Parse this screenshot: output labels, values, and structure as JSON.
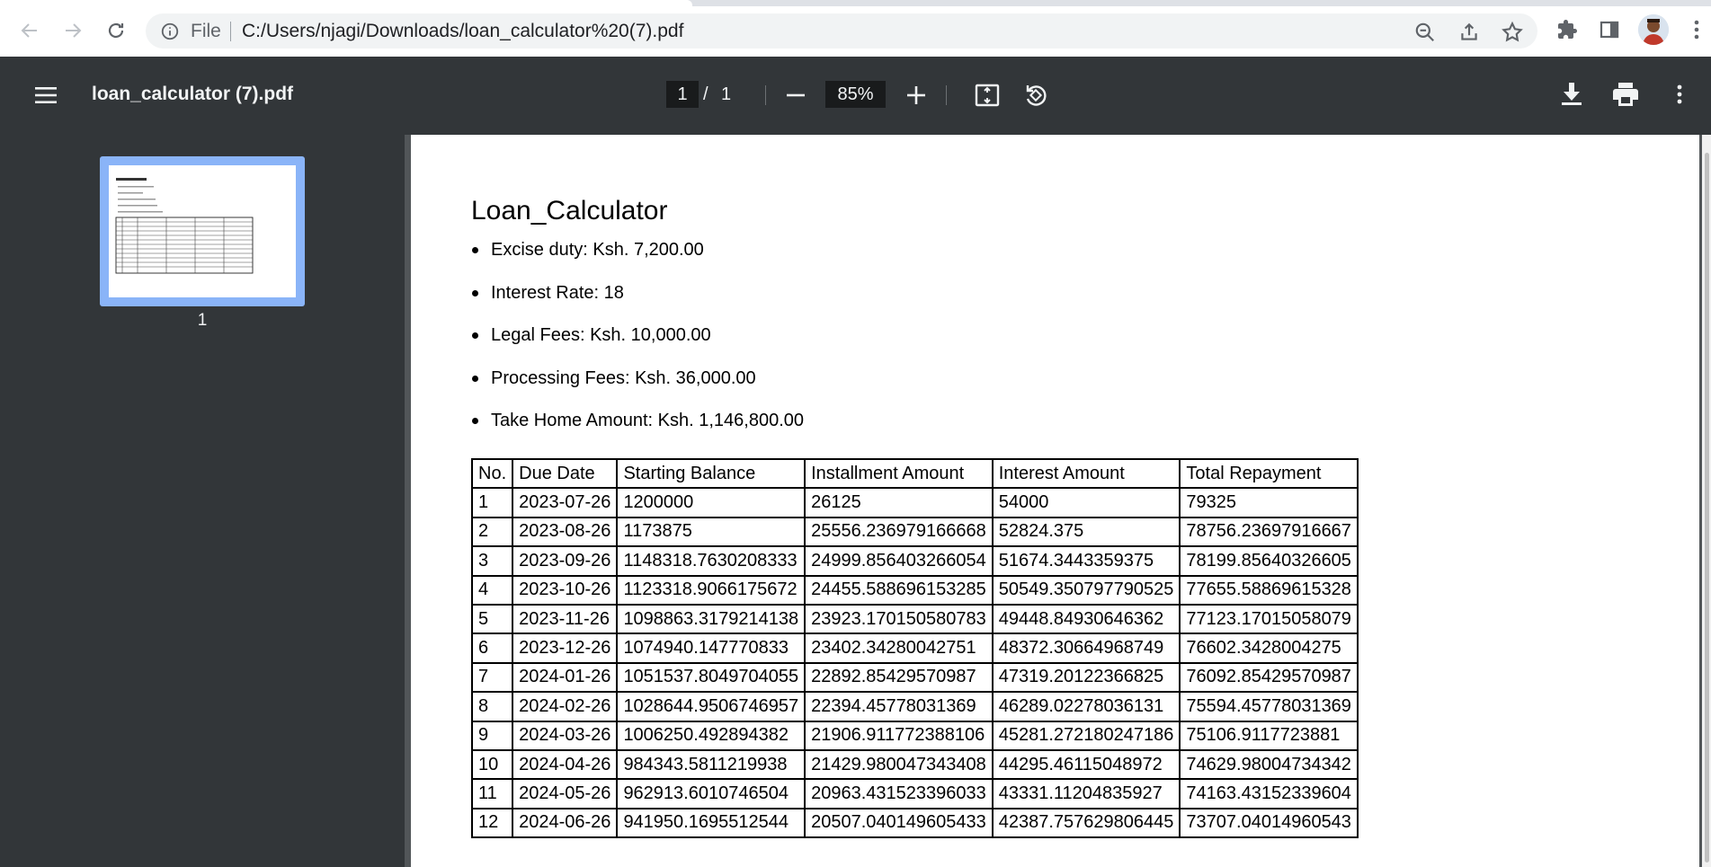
{
  "browser": {
    "omnibox_scheme": "File",
    "url": "C:/Users/njagi/Downloads/loan_calculator%20(7).pdf"
  },
  "viewer": {
    "doc_title": "loan_calculator (7).pdf",
    "current_page": "1",
    "page_separator": "/",
    "total_pages": "1",
    "zoom": "85%",
    "thumbnail_label": "1"
  },
  "document": {
    "title": "Loan_Calculator",
    "bullets": [
      "Excise duty: Ksh. 7,200.00",
      "Interest Rate: 18",
      "Legal Fees: Ksh. 10,000.00",
      "Processing Fees: Ksh. 36,000.00",
      "Take Home Amount: Ksh. 1,146,800.00"
    ],
    "table": {
      "headers": [
        "No.",
        "Due Date",
        "Starting Balance",
        "Installment Amount",
        "Interest Amount",
        "Total Repayment"
      ],
      "rows": [
        [
          "1",
          "2023-07-26",
          "1200000",
          "26125",
          "54000",
          "79325"
        ],
        [
          "2",
          "2023-08-26",
          "1173875",
          "25556.236979166668",
          "52824.375",
          "78756.23697916667"
        ],
        [
          "3",
          "2023-09-26",
          "1148318.7630208333",
          "24999.856403266054",
          "51674.3443359375",
          "78199.85640326605"
        ],
        [
          "4",
          "2023-10-26",
          "1123318.9066175672",
          "24455.588696153285",
          "50549.350797790525",
          "77655.58869615328"
        ],
        [
          "5",
          "2023-11-26",
          "1098863.3179214138",
          "23923.170150580783",
          "49448.84930646362",
          "77123.17015058079"
        ],
        [
          "6",
          "2023-12-26",
          "1074940.147770833",
          "23402.34280042751",
          "48372.30664968749",
          "76602.3428004275"
        ],
        [
          "7",
          "2024-01-26",
          "1051537.8049704055",
          "22892.85429570987",
          "47319.20122366825",
          "76092.85429570987"
        ],
        [
          "8",
          "2024-02-26",
          "1028644.9506746957",
          "22394.45778031369",
          "46289.02278036131",
          "75594.45778031369"
        ],
        [
          "9",
          "2024-03-26",
          "1006250.492894382",
          "21906.911772388106",
          "45281.272180247186",
          "75106.9117723881"
        ],
        [
          "10",
          "2024-04-26",
          "984343.5811219938",
          "21429.980047343408",
          "44295.46115048972",
          "74629.98004734342"
        ],
        [
          "11",
          "2024-05-26",
          "962913.6010746504",
          "20963.431523396033",
          "43331.11204835927",
          "74163.43152339604"
        ],
        [
          "12",
          "2024-06-26",
          "941950.1695512544",
          "20507.040149605433",
          "42387.757629806445",
          "73707.04014960543"
        ]
      ]
    }
  },
  "icons": {
    "back": "arrow-left-icon",
    "forward": "arrow-right-icon",
    "reload": "reload-icon",
    "info": "info-icon",
    "zoom_out": "zoom-out-icon",
    "share": "share-icon",
    "bookmark": "star-icon",
    "extensions": "puzzle-icon",
    "side_panel": "side-panel-icon",
    "menu": "kebab-menu-icon",
    "sidebar_toggle": "hamburger-icon",
    "fit": "fit-page-icon",
    "rotate": "rotate-icon",
    "download": "download-icon",
    "print": "print-icon"
  },
  "colors": {
    "toolbar_bg": "#323639",
    "viewer_bg": "#525659",
    "thumbnail_highlight": "#8ab4f8"
  }
}
